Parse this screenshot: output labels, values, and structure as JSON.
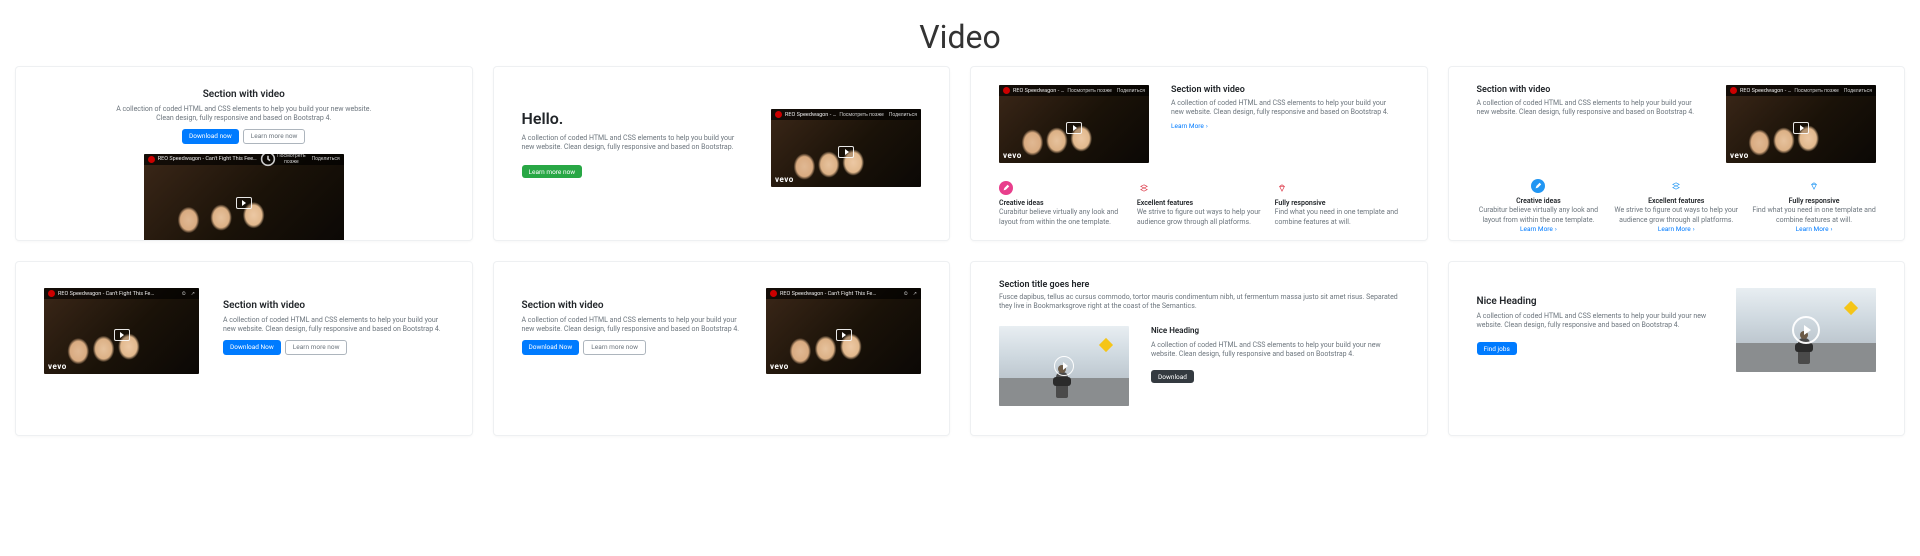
{
  "page_title": "Video",
  "video_title_short": "REO Speedwagon - Can't Fight This Fe…",
  "video_title_long": "REO Speedwagon - Can't Fight This Feeling (Official Music Video)",
  "video_ctrl_later": "Посмотреть позже",
  "video_ctrl_share": "Поделиться",
  "vevo": "vevo",
  "cards": [
    {
      "title": "Section with video",
      "desc": "A collection of coded HTML and CSS elements to help you build your new website. Clean design, fully responsive and based on Bootstrap 4.",
      "btn_primary": "Download now",
      "btn_outline": "Learn more now"
    },
    {
      "title": "Hello.",
      "desc": "A collection of coded HTML and CSS elements to help you build your new website. Clean design, fully responsive and based on Bootstrap.",
      "btn_success": "Learn more now"
    },
    {
      "title": "Section with video",
      "desc": "A collection of coded HTML and CSS elements to help your build your new website. Clean design, fully responsive and based on Bootstrap 4.",
      "link": "Learn More",
      "features": [
        {
          "title": "Creative ideas",
          "desc": "Curabitur believe virtually any look and layout from within the one template.",
          "color": "#e83e8c"
        },
        {
          "title": "Excellent features",
          "desc": "We strive to figure out ways to help your audience grow through all platforms.",
          "color": "#dc3545"
        },
        {
          "title": "Fully responsive",
          "desc": "Find what you need in one template and combine features at will.",
          "color": "#dc3545"
        }
      ]
    },
    {
      "title": "Section with video",
      "desc": "A collection of coded HTML and CSS elements to help your build your new website. Clean design, fully responsive and based on Bootstrap 4.",
      "features": [
        {
          "title": "Creative ideas",
          "desc": "Curabitur believe virtually any look and layout from within the one template.",
          "link": "Learn More"
        },
        {
          "title": "Excellent features",
          "desc": "We strive to figure out ways to help your audience grow through all platforms.",
          "link": "Learn More"
        },
        {
          "title": "Fully responsive",
          "desc": "Find what you need in one template and combine features at will.",
          "link": "Learn More"
        }
      ],
      "feature_color": "#2196f3"
    },
    {
      "title": "Section with video",
      "desc": "A collection of coded HTML and CSS elements to help your build your new website. Clean design, fully responsive and based on Bootstrap 4.",
      "btn_primary": "Download Now",
      "btn_outline": "Learn more now"
    },
    {
      "title": "Section with video",
      "desc": "A collection of coded HTML and CSS elements to help your build your new website. Clean design, fully responsive and based on Bootstrap 4.",
      "btn_primary": "Download Now",
      "btn_outline": "Learn more now"
    },
    {
      "title": "Section title goes here",
      "subdesc": "Fusce dapibus, tellus ac cursus commodo, tortor mauris condimentum nibh, ut fermentum massa justo sit amet risus. Separated they live in Bookmarksgrove right at the coast of the Semantics.",
      "item_title": "Nice Heading",
      "item_desc": "A collection of coded HTML and CSS elements to help your build your new website. Clean design, fully responsive and based on Bootstrap 4.",
      "btn_dark": "Download"
    },
    {
      "title": "Nice Heading",
      "desc": "A collection of coded HTML and CSS elements to help your build your new website. Clean design, fully responsive and based on Bootstrap 4.",
      "btn_primary": "Find jobs"
    }
  ]
}
